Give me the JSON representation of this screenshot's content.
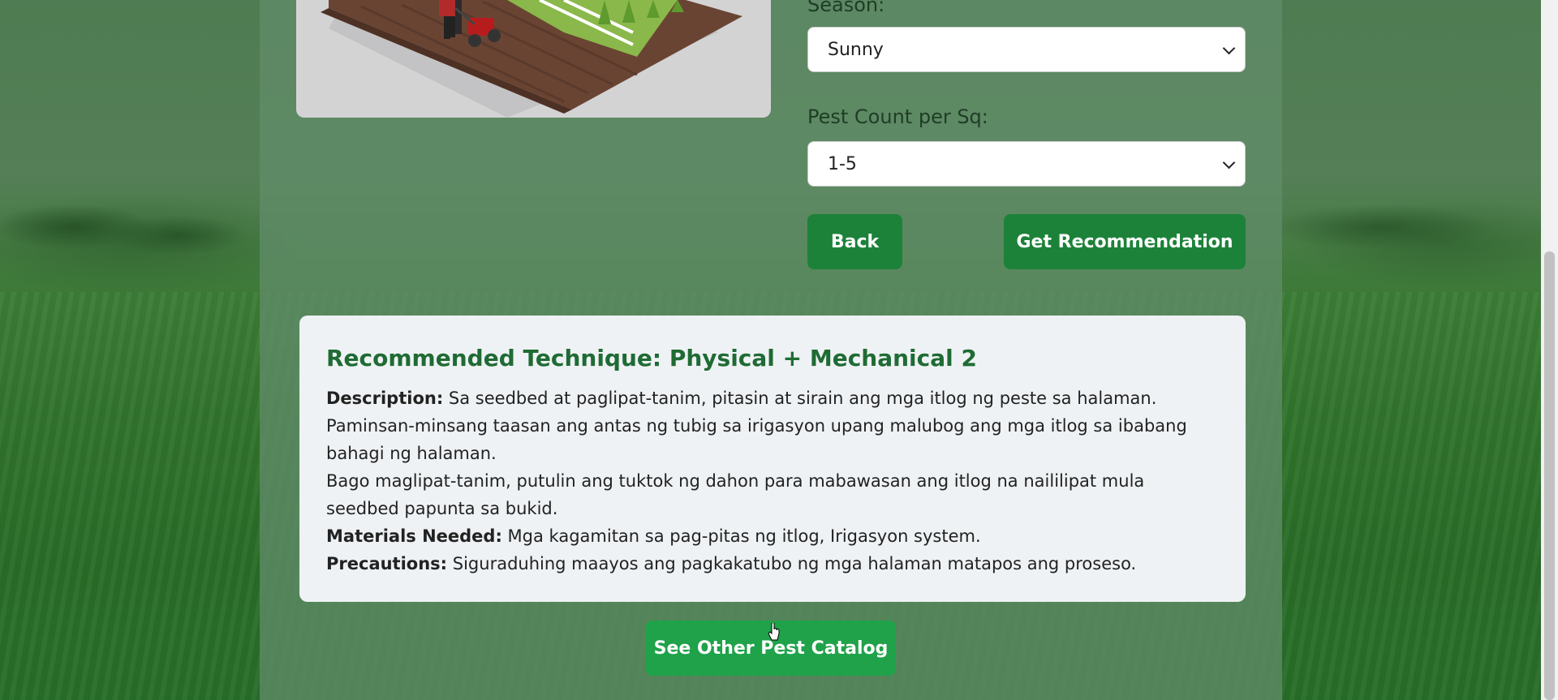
{
  "form": {
    "season_label": "Season:",
    "season_value": "Sunny",
    "pest_count_label": "Pest Count per Sq:",
    "pest_count_value": "1-5"
  },
  "buttons": {
    "back": "Back",
    "get_recommendation": "Get Recommendation",
    "see_catalog": "See Other Pest Catalog"
  },
  "result": {
    "title": "Recommended Technique: Physical + Mechanical 2",
    "description_label": "Description:",
    "description_line1": "Sa seedbed at paglipat-tanim, pitasin at sirain ang mga itlog ng peste sa halaman.",
    "description_line2": "Paminsan-minsang taasan ang antas ng tubig sa irigasyon upang malubog ang mga itlog sa ibabang bahagi ng halaman.",
    "description_line3": "Bago maglipat-tanim, putulin ang tuktok ng dahon para mabawasan ang itlog na naililipat mula seedbed papunta sa bukid.",
    "materials_label": "Materials Needed:",
    "materials_value": "Mga kagamitan sa pag-pitas ng itlog, Irigasyon system.",
    "precautions_label": "Precautions:",
    "precautions_value": "Siguraduhing maayos ang pagkakatubo ng mga halaman matapos ang proseso."
  },
  "colors": {
    "primary_green": "#1c8239",
    "catalog_green": "#1fa24a",
    "title_green": "#1f6b34",
    "card_bg": "#eff2f4"
  }
}
